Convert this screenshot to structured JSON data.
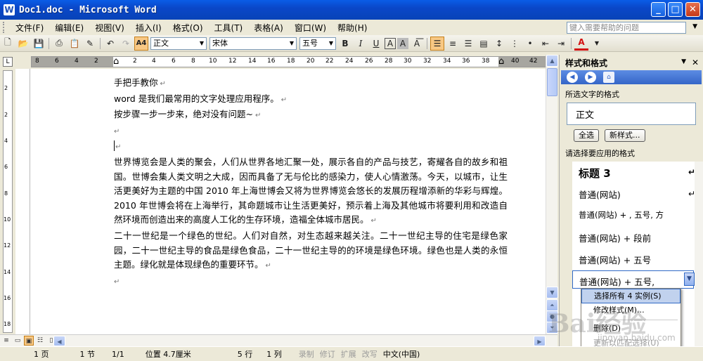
{
  "window": {
    "title": "Doc1.doc - Microsoft Word",
    "icon": "word-doc-icon"
  },
  "menubar": {
    "items": [
      "文件(F)",
      "编辑(E)",
      "视图(V)",
      "插入(I)",
      "格式(O)",
      "工具(T)",
      "表格(A)",
      "窗口(W)",
      "帮助(H)"
    ],
    "help_placeholder": "键入需要帮助的问题"
  },
  "toolbar": {
    "style_value": "正文",
    "font_value": "宋体",
    "size_value": "五号",
    "bold": "B",
    "italic": "I",
    "underline": "U",
    "font_color_label": "A",
    "style_button_label": "A4"
  },
  "ruler": {
    "labels": [
      "8",
      "6",
      "4",
      "2",
      "2",
      "4",
      "6",
      "8",
      "10",
      "12",
      "14",
      "16",
      "18",
      "20",
      "22",
      "24",
      "26",
      "28",
      "30",
      "32",
      "34",
      "36",
      "38",
      "40",
      "42",
      "44"
    ],
    "vlabels": [
      "2",
      "2",
      "4",
      "6",
      "8",
      "10",
      "12",
      "14",
      "16",
      "18"
    ],
    "corner": "L"
  },
  "document": {
    "lines": [
      "手把手教你",
      "word 是我们最常用的文字处理应用程序。",
      "按步骤一步一步来，绝对没有问题~",
      "",
      ""
    ],
    "paragraph1": "世界博览会是人类的聚会，人们从世界各地汇聚一处，展示各自的产品与技艺，寄耀各自的故乡和祖国。世博会集人类文明之大成，因而具备了无与伦比的感染力，使人心情激荡。今天，以城市，让生活更美好为主题的中国 2010 年上海世博会又将为世界博览会悠长的发展历程增添新的华彩与辉煌。2010 年世博会将在上海举行，其命题城市让生活更美好，预示着上海及其他城市将要利用和改造自然环境而创造出来的高度人工化的生存环境，造福全体城市居民。",
    "paragraph2": "二十一世纪是一个绿色的世纪。人们对自然，对生态越来越关注。二十一世纪主导的住宅是绿色家园，二十一世纪主导的食品是绿色食品，二十一世纪主导的的环境是绿色环境。绿色也是人类的永恒主题。绿化就是体现绿色的重要环节。",
    "paragraph_mark": "↵"
  },
  "taskpane": {
    "title": "样式和格式",
    "selected_label": "所选文字的格式",
    "selected_format": "正文",
    "select_all": "全选",
    "new_style": "新样式...",
    "apply_label": "请选择要应用的格式",
    "styles": [
      "标题 3",
      "普通(网站)",
      "普通(网站) + , 五号, 方",
      "普通(网站) + 段前",
      "普通(网站) + 五号",
      "普通(网站) + 五号,"
    ]
  },
  "context_menu": {
    "items": [
      "选择所有 4 实例(S)",
      "修改样式(M)...",
      "删除(D)",
      "更新以匹配选择(U)"
    ]
  },
  "statusbar": {
    "page": "1 页",
    "section": "1 节",
    "pages": "1/1",
    "position": "位置 4.7厘米",
    "line": "5 行",
    "col": "1 列",
    "rec": "录制",
    "trk": "修订",
    "ext": "扩展",
    "ovr": "改写",
    "lang": "中文(中国)"
  },
  "watermark": {
    "brand": "Bai经验",
    "url": "jingyan.baidu.com"
  }
}
